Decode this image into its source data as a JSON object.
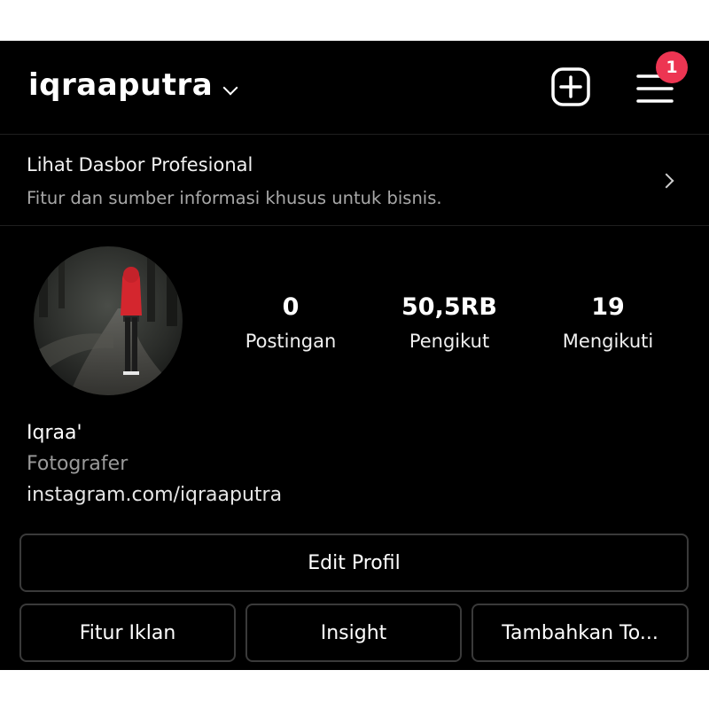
{
  "header": {
    "username": "iqraaputra",
    "menu_badge": "1"
  },
  "dashboard_banner": {
    "title": "Lihat Dasbor Profesional",
    "subtitle": "Fitur dan sumber informasi khusus untuk bisnis."
  },
  "stats": [
    {
      "value": "0",
      "label": "Postingan"
    },
    {
      "value": "50,5RB",
      "label": "Pengikut"
    },
    {
      "value": "19",
      "label": "Mengikuti"
    }
  ],
  "bio": {
    "name": "Iqraa'",
    "category": "Fotografer",
    "link": "instagram.com/iqraaputra"
  },
  "buttons": {
    "edit_profile": "Edit Profil",
    "ads": "Fitur Iklan",
    "insight": "Insight",
    "add": "Tambahkan To..."
  },
  "colors": {
    "background": "#000000",
    "badge": "#ed3552",
    "secondary_text": "#a8a8a8"
  },
  "icons": {
    "add": "plus-square-icon",
    "menu": "hamburger-menu-icon",
    "dropdown": "chevron-down-icon",
    "banner_arrow": "chevron-right-icon"
  }
}
